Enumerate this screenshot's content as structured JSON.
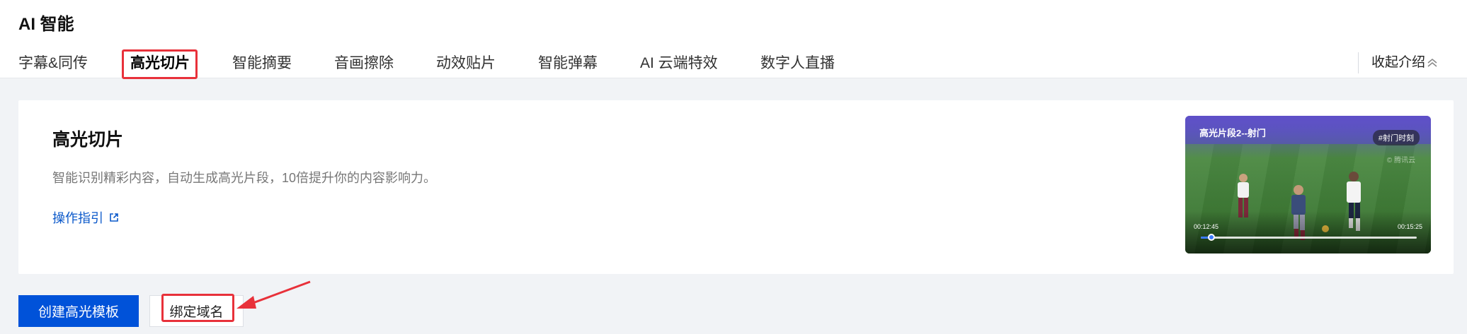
{
  "page_title": "AI 智能",
  "tabs": [
    {
      "label": "字幕&同传",
      "active": false
    },
    {
      "label": "高光切片",
      "active": true
    },
    {
      "label": "智能摘要",
      "active": false
    },
    {
      "label": "音画擦除",
      "active": false
    },
    {
      "label": "动效贴片",
      "active": false
    },
    {
      "label": "智能弹幕",
      "active": false
    },
    {
      "label": "AI 云端特效",
      "active": false
    },
    {
      "label": "数字人直播",
      "active": false
    }
  ],
  "collapse_label": "收起介绍",
  "card": {
    "title": "高光切片",
    "description": "智能识别精彩内容，自动生成高光片段，10倍提升你的内容影响力。",
    "guide_link": "操作指引",
    "thumbnail": {
      "title": "高光片段2--射门",
      "tag": "#射门时刻",
      "watermark": "© 腾讯云",
      "time_current": "00:12:45",
      "time_total": "00:15:25",
      "progress": 0.05
    }
  },
  "buttons": {
    "create_template": "创建高光模板",
    "bind_domain": "绑定域名"
  },
  "colors": {
    "primary": "#0052d9",
    "highlight_red": "#e8313a",
    "link": "#0a58ca"
  }
}
